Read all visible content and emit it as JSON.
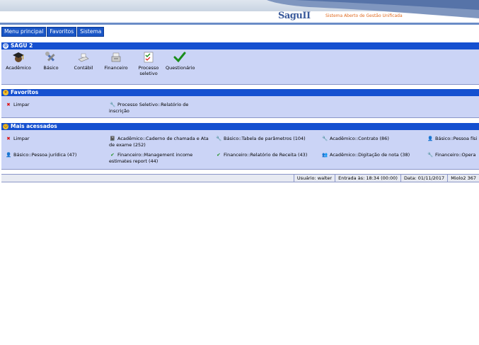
{
  "header": {
    "logo_text": "Sagu",
    "logo_version": "II",
    "tagline": "Sistema Aberto de Gestão Unificada"
  },
  "menu": {
    "items": [
      "Menu principal",
      "Favoritos",
      "Sistema"
    ]
  },
  "sagu2": {
    "title": "SAGU 2",
    "modules": [
      {
        "label": "Acadêmico",
        "icon": "graduation-cap-icon"
      },
      {
        "label": "Básico",
        "icon": "tools-icon"
      },
      {
        "label": "Contábil",
        "icon": "calculator-icon"
      },
      {
        "label": "Financeiro",
        "icon": "cash-register-icon"
      },
      {
        "label": "Processo seletivo",
        "icon": "form-icon"
      },
      {
        "label": "Questionário",
        "icon": "check-icon"
      }
    ]
  },
  "favoritos": {
    "title": "Favoritos",
    "items": [
      {
        "label": "Limpar",
        "icon": "x-icon"
      },
      {
        "label": "Processo Seletivo::Relatório de inscrição",
        "icon": "wrench-icon"
      }
    ]
  },
  "mais_acessados": {
    "title": "Mais acessados",
    "items": [
      {
        "label": "Limpar",
        "icon": "x-icon"
      },
      {
        "label": "Acadêmico::Caderno de chamada e Ata de exame (252)",
        "icon": "notebook-icon"
      },
      {
        "label": "Básico::Tabela de parâmetros (104)",
        "icon": "tools-icon"
      },
      {
        "label": "Acadêmico::Contrato (86)",
        "icon": "wrench-icon"
      },
      {
        "label": "Básico::Pessoa físi",
        "icon": "person-icon"
      },
      {
        "label": "Básico::Pessoa jurídica (47)",
        "icon": "person-icon"
      },
      {
        "label": "Financeiro::Management income estimates report (44)",
        "icon": "check-doc-icon"
      },
      {
        "label": "Financeiro::Relatório de Receita (43)",
        "icon": "check-doc-icon"
      },
      {
        "label": "Acadêmico::Digitação de nota (38)",
        "icon": "people-icon"
      },
      {
        "label": "Financeiro::Opera",
        "icon": "wrench-icon"
      }
    ]
  },
  "status": {
    "usuario": "Usuário: walter",
    "entrada": "Entrada às: 18:34 (00:00)",
    "data": "Data: 01/11/2017",
    "versao": "Miolo2 367"
  }
}
